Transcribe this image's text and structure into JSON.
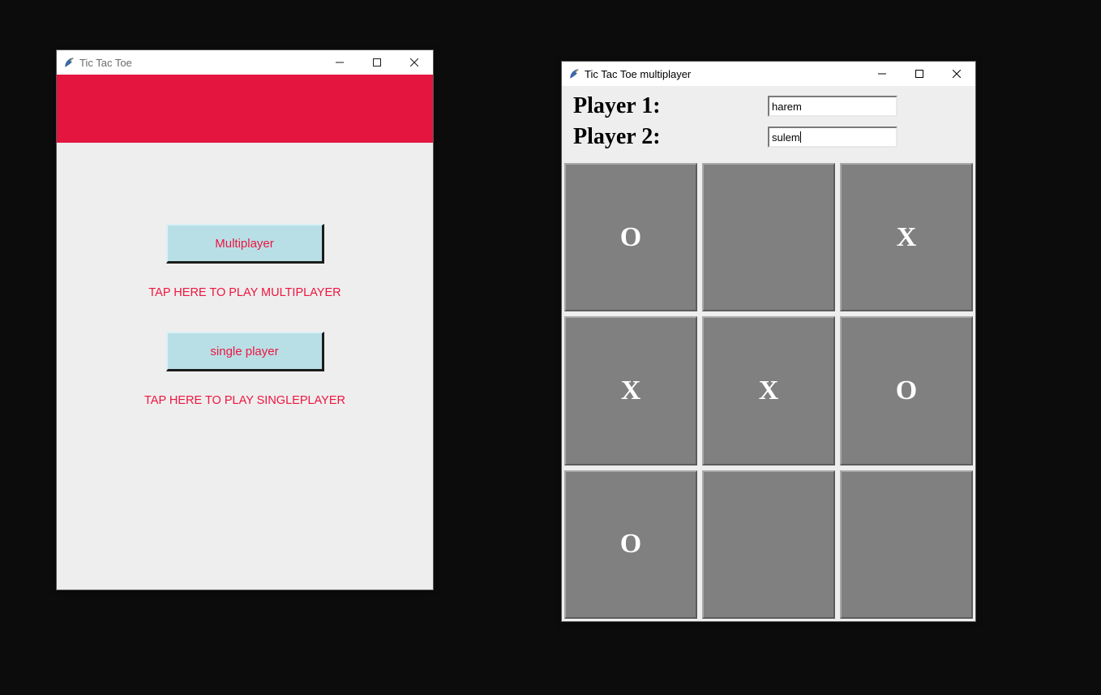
{
  "window1": {
    "title": "Tic Tac Toe",
    "buttons": {
      "multiplayer": "Multiplayer",
      "singleplayer": "single player"
    },
    "captions": {
      "multiplayer": "TAP HERE TO PLAY MULTIPLAYER",
      "singleplayer": "TAP HERE TO PLAY SINGLEPLAYER"
    },
    "colors": {
      "banner": "#e4163f",
      "button_bg": "#b8dfe6",
      "text": "#ee153f"
    }
  },
  "window2": {
    "title": "Tic Tac Toe multiplayer",
    "players": {
      "label1": "Player 1:",
      "label2": "Player 2:",
      "value1": "harem",
      "value2": "sulem"
    },
    "board": [
      [
        "O",
        "",
        "X"
      ],
      [
        "X",
        "X",
        "O"
      ],
      [
        "O",
        "",
        ""
      ]
    ]
  },
  "icons": {
    "feather": "tk-feather-icon",
    "minimize": "minimize-icon",
    "maximize": "maximize-icon",
    "close": "close-icon"
  }
}
